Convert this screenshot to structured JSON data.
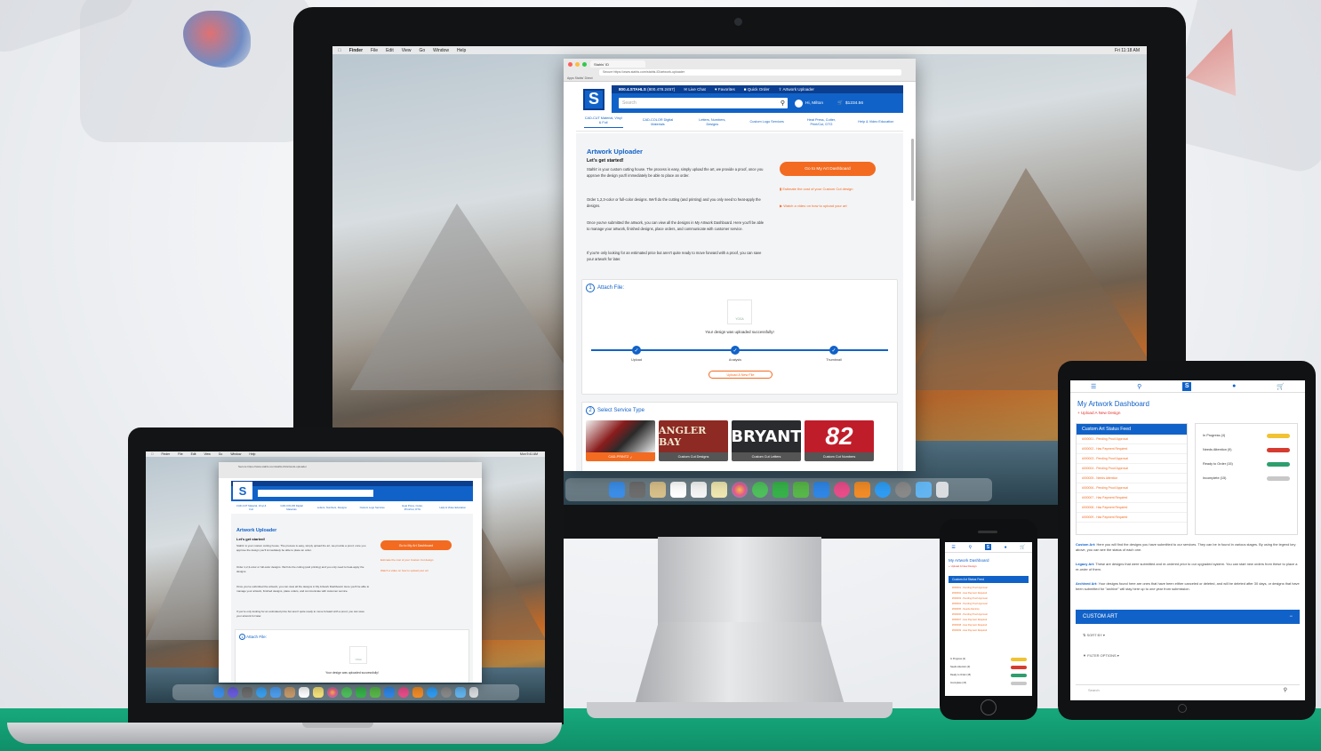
{
  "colors": {
    "brand_blue": "#1162c8",
    "brand_navy": "#0b3e8f",
    "accent_orange": "#f26b21",
    "alert_red": "#e0332a",
    "floor_green": "#17a97c",
    "status_yellow": "#f1c232",
    "status_red": "#d63b2f",
    "status_green": "#2e9e6d",
    "status_gray": "#c8c8c8"
  },
  "mac_menubar": {
    "items": [
      "Finder",
      "File",
      "Edit",
      "View",
      "Go",
      "Window",
      "Help"
    ],
    "clock": "Fri 11:18 AM"
  },
  "browser": {
    "tab_label": "Stahls' ID",
    "url": "Secure https://www.stahls.com/stahls-ID/artwork-uploader",
    "bookmarks": "Apps  Stahls' Direct"
  },
  "site": {
    "logo_letter": "S",
    "phone": "800.4.STAHLS",
    "phone_alt": "(800.478.2457)",
    "topbar_links": [
      "Live Chat",
      "Favorites",
      "Quick Order",
      "Artwork Uploader"
    ],
    "search_placeholder": "Search",
    "user_greeting": "Hi, Milton",
    "cart_total": "$1234.56",
    "cart_count": "2",
    "nav": [
      "CAD-CUT Material, Vinyl & Foil",
      "CAD-COLOR Digital Materials",
      "Letters, Numbers, Designs",
      "Custom Logo Services",
      "Heat Press, Cutter, Print/Cut, DTG",
      "Help & Video Education"
    ]
  },
  "uploader": {
    "title": "Artwork Uploader",
    "subtitle": "Let's get started!",
    "paragraphs": [
      "Stahls' is your custom cutting house. The process is easy, simply upload the art, we provide a proof, once you approve the design you'll immediately be able to place an order.",
      "Order 1,2,3-color or full-color designs. We'll do the cutting (and printing) and you only need to heat-apply the designs.",
      "Once you've submitted the artwork, you can view all the designs in My Artwork Dashboard. Here you'll be able to manage your artwork, finished designs, place orders, and communicate with customer service.",
      "If you're only looking for an estimated price but aren't quite ready to move forward with a proof, you can save your artwork for later."
    ],
    "dashboard_button": "Go to My Art Dashboard",
    "link_estimate": "Estimate the cost of your Custom Cut design",
    "link_video": "Watch a video on how to upload your art",
    "attach_step_num": "1",
    "attach_title": "Attach File:",
    "thumb_caption": "YOGA",
    "upload_success": "Your design was uploaded successfully!",
    "steps": [
      "Upload",
      "Analysis",
      "Thumbnail"
    ],
    "upload_new": "Upload A New File",
    "service_step_num": "2",
    "service_title": "Select Service Type",
    "services": [
      {
        "caption": "CAD-PRINTZ",
        "art": "",
        "selected": true
      },
      {
        "caption": "Custom Cut Designs",
        "art": "ANGLER BAY"
      },
      {
        "caption": "Custom Cut Letters",
        "art": "BRYANT"
      },
      {
        "caption": "Custom Cut Numbers",
        "art": "82"
      }
    ]
  },
  "laptop": {
    "clock": "Mon 9:41 AM",
    "title": "Artwork Uploader",
    "subtitle": "Let's get started!",
    "button": "Go to My Art Dashboard",
    "attach_title": "Attach File:",
    "upload_success": "Your design was uploaded successfully!"
  },
  "dashboard": {
    "title": "My Artwork Dashboard",
    "upload_link": "+ Upload A New Design",
    "feed_title": "Custom Art Status Feed",
    "feed_items": [
      "#000001 - Pending Proof Approval",
      "#000002 - Has Payment Required",
      "#000003 - Pending Proof Approval",
      "#000004 - Pending Proof Approval",
      "#000005 - Needs Attention",
      "#000006 - Pending Proof Approval",
      "#000007 - Has Payment Required",
      "#000008 - Has Payment Required",
      "#000009 - Has Payment Required"
    ],
    "legend": [
      {
        "label": "In Progress (4)",
        "color": "#f1c232"
      },
      {
        "label": "Needs Attention (9)",
        "color": "#d63b2f"
      },
      {
        "label": "Ready to Order (15)",
        "color": "#2e9e6d"
      },
      {
        "label": "Incomplete (15)",
        "color": "#c8c8c8"
      }
    ],
    "custom_art_label": "Custom Art:",
    "custom_art_text": "Here you will find the designs you have submitted to our services. They can be in found in various stages. By using the legend key above, you can see the status of each one.",
    "legacy_art_label": "Legacy Art:",
    "legacy_art_text": "These are designs that were submitted and re-ordered prior to our upgraded system. You can start new orders from these to place a re-order of them.",
    "archived_art_label": "Archived Art:",
    "archived_art_text": "Your designs found here are ones that have been either canceled or deleted, and will be deleted after 30 days, or designs that have been submitted for \"archive\" will stay here up to one year from submission.",
    "section_title": "CUSTOM ART",
    "section_toggle": "−",
    "sort_label": "SORT BY",
    "filter_label": "FILTER OPTIONS",
    "search_placeholder": "Search"
  }
}
